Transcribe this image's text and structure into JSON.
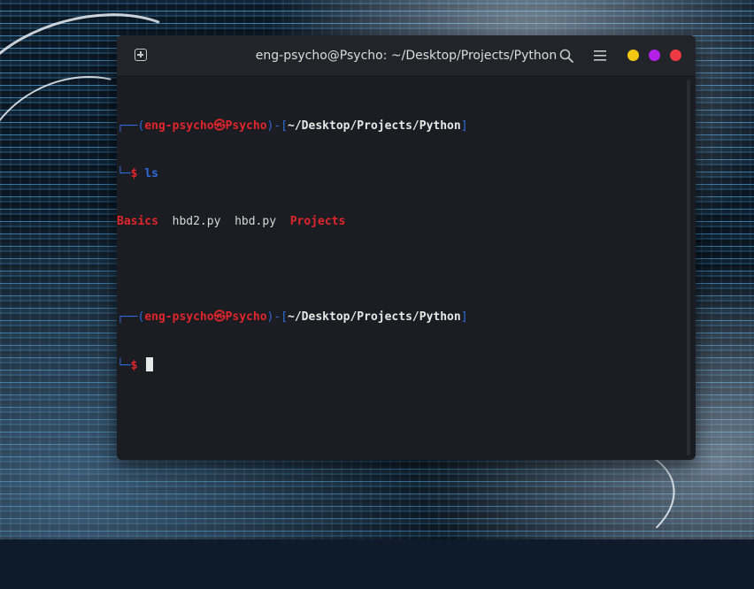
{
  "colors": {
    "window_bg": "#1b1d23",
    "titlebar_bg": "#222429",
    "prompt_blue": "#2f6bdc",
    "prompt_red": "#e0262c",
    "dot_yellow": "#f2c813",
    "dot_purple": "#b21fe6",
    "dot_red": "#ee3a42"
  },
  "window": {
    "title": "eng-psycho@Psycho: ~/Desktop/Projects/Python",
    "new_tab_icon": "new-tab-icon",
    "search_icon": "search-icon",
    "menu_icon": "hamburger-menu-icon"
  },
  "terminal": {
    "prompt1": {
      "corner_top": "┌──(",
      "user_host": "eng-psycho㉿Psycho",
      "mid": ")-[",
      "path": "~/Desktop/Projects/Python",
      "close": "]",
      "corner_bottom": "└─",
      "symbol": "$",
      "command": " ls"
    },
    "ls_output": [
      "Basics",
      "hbd2.py",
      "hbd.py",
      "Projects"
    ],
    "prompt2": {
      "corner_top": "┌──(",
      "user_host": "eng-psycho㉿Psycho",
      "mid": ")-[",
      "path": "~/Desktop/Projects/Python",
      "close": "]",
      "corner_bottom": "└─",
      "symbol": "$"
    }
  }
}
